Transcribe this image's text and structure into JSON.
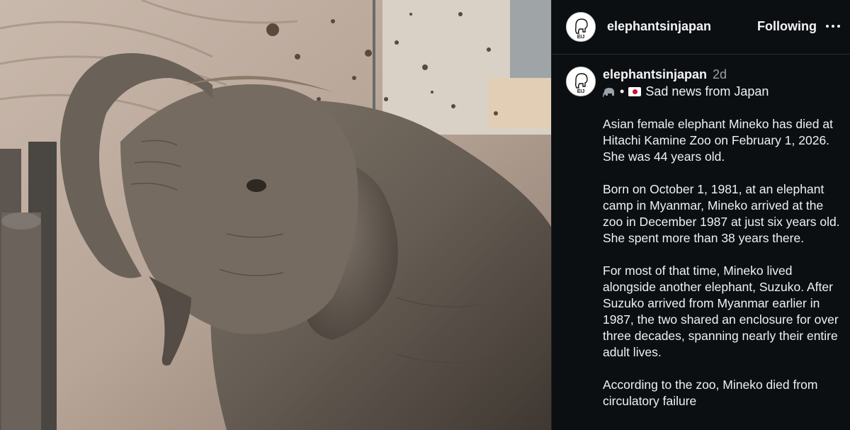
{
  "photo": {
    "alt": "elephant-photo"
  },
  "header": {
    "avatar_text": "EIJ",
    "username": "elephantsinjapan",
    "follow_label": "Following",
    "more_icon": "more-horizontal-icon"
  },
  "post": {
    "avatar_text": "EIJ",
    "username": "elephantsinjapan",
    "age": "2d",
    "subtitle_separator": "•",
    "subtitle": "Sad news from Japan",
    "icons": [
      "elephant-emoji",
      "japan-flag-emoji"
    ],
    "paragraphs": [
      "Asian female elephant Mineko has died at Hitachi Kamine Zoo on February 1, 2026. She was 44 years old.",
      "Born on October 1, 1981, at an elephant camp in Myanmar, Mineko arrived at the zoo in December 1987 at just six years old. She spent more than 38 years there.",
      "For most of that time, Mineko lived alongside another elephant, Suzuko. After Suzuko arrived from Myanmar earlier in 1987, the two shared an enclosure for over three decades, spanning nearly their entire adult lives.",
      "According to the zoo, Mineko died from circulatory failure"
    ]
  },
  "colors": {
    "panel_bg": "#0c0f12",
    "text": "#f5f5f5",
    "muted": "#9aa0a6",
    "flag_red": "#d0102b"
  }
}
